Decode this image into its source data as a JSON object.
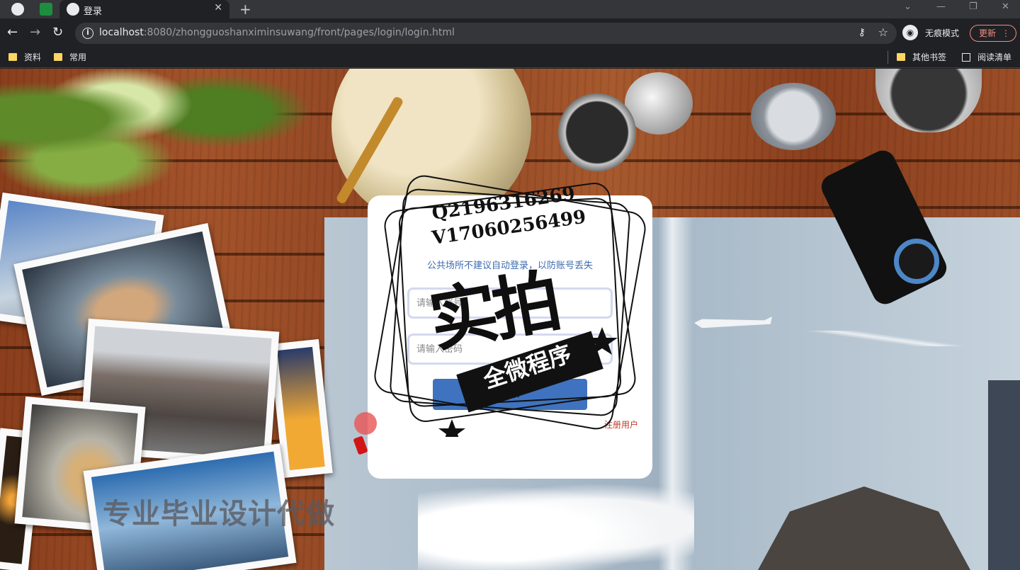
{
  "browser": {
    "tabs": [
      {
        "title": ""
      },
      {
        "title": ""
      },
      {
        "title": "登录",
        "active": true
      }
    ],
    "new_tab_icon": "plus-icon",
    "window_controls": [
      "chevron-down-icon",
      "minimize-icon",
      "restore-icon",
      "close-icon"
    ],
    "url_host": "localhost",
    "url_rest": ":8080/zhongguoshanximinsuwang/front/pages/login/login.html",
    "incognito_label": "无痕模式",
    "update_label": "更新",
    "bookmarks": [
      "资料",
      "常用"
    ],
    "bookmarks_right": [
      "其他书签",
      "阅读清单"
    ]
  },
  "login": {
    "hint": "公共场所不建议自动登录，以防账号丢失",
    "username_placeholder": "请输入账号",
    "password_placeholder": "请输入密码",
    "login_label": "登录",
    "register_label": "注册用户"
  },
  "watermark": {
    "qq": "Q2196316269",
    "wechat": "V17060256499",
    "headline": "实拍",
    "banner": "全微程序"
  },
  "background_slogan": "专业毕业设计代做",
  "colors": {
    "login_button": "#3f73bf",
    "hint_text": "#3d6bb0",
    "register_link": "#c0392b",
    "update_accent": "#f28b82"
  }
}
